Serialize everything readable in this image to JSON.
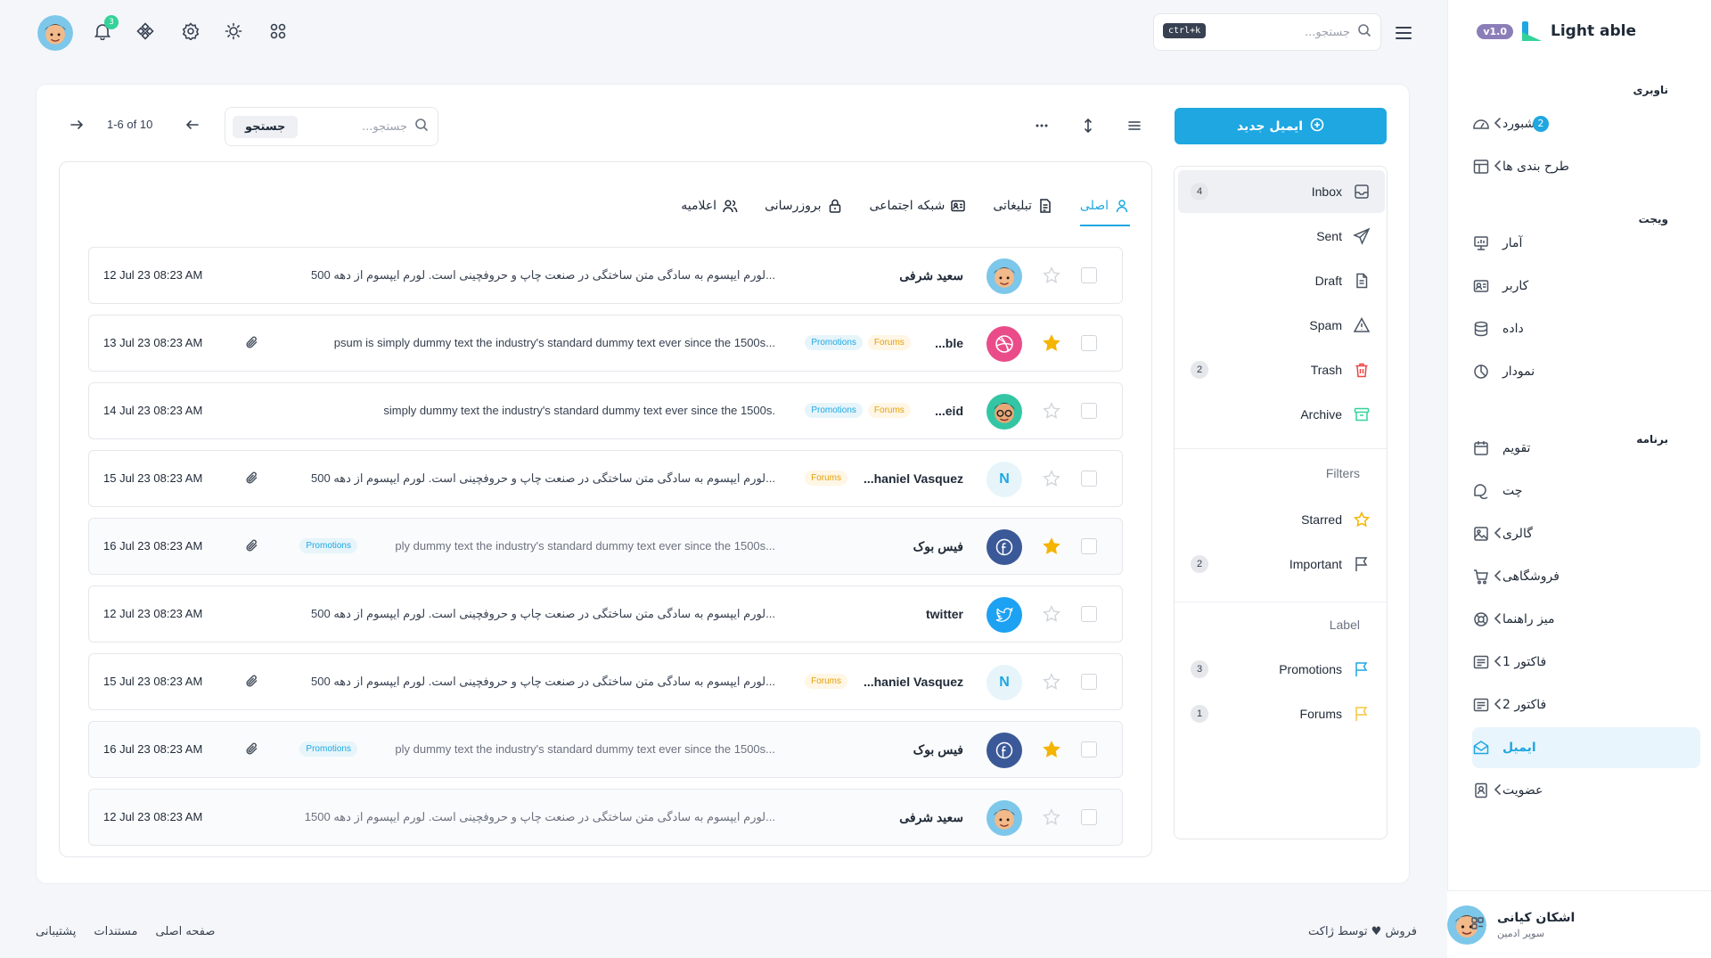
{
  "brand": {
    "name": "Light able",
    "version": "v1.0"
  },
  "sidebar": {
    "sections": [
      "ناوبری",
      "ویجت",
      "برنامه"
    ],
    "items": [
      {
        "label": "داشبورد",
        "icon": "dashboard-icon",
        "badge": "2",
        "chevron": true
      },
      {
        "label": "طرح بندی ها",
        "icon": "layout-icon",
        "chevron": true
      },
      {
        "label": "آمار",
        "icon": "statistics-icon"
      },
      {
        "label": "کاربر",
        "icon": "user-card-icon"
      },
      {
        "label": "داده",
        "icon": "database-icon"
      },
      {
        "label": "نمودار",
        "icon": "chart-pie-icon"
      },
      {
        "label": "تقویم",
        "icon": "calendar-icon"
      },
      {
        "label": "چت",
        "icon": "chat-icon"
      },
      {
        "label": "گالری",
        "icon": "gallery-icon",
        "chevron": true
      },
      {
        "label": "فروشگاهی",
        "icon": "cart-icon",
        "chevron": true
      },
      {
        "label": "میز راهنما",
        "icon": "helpdesk-icon",
        "chevron": true
      },
      {
        "label": "فاکتور 1",
        "icon": "invoice-icon",
        "chevron": true
      },
      {
        "label": "فاکتور 2",
        "icon": "invoice-icon",
        "chevron": true
      },
      {
        "label": "ایمیل",
        "icon": "email-icon",
        "active": true
      },
      {
        "label": "عضویت",
        "icon": "membership-icon",
        "chevron": true
      }
    ],
    "user": {
      "name": "اشکان کیانی",
      "role": "سوپر ادمین"
    }
  },
  "topbar": {
    "search_placeholder": "جستجو...",
    "shortcut": "ctrl+k",
    "notification_count": "3"
  },
  "mail": {
    "compose_label": "ایمیل جدید",
    "folders": [
      {
        "label": "Inbox",
        "icon": "inbox-icon",
        "count": "4",
        "active": true
      },
      {
        "label": "Sent",
        "icon": "send-icon"
      },
      {
        "label": "Draft",
        "icon": "file-icon"
      },
      {
        "label": "Spam",
        "icon": "warning-icon"
      },
      {
        "label": "Trash",
        "icon": "trash-icon",
        "count": "2"
      },
      {
        "label": "Archive",
        "icon": "archive-icon"
      }
    ],
    "filters_heading": "Filters",
    "filters": [
      {
        "label": "Starred",
        "icon": "star-icon"
      },
      {
        "label": "Important",
        "icon": "flag-icon",
        "count": "2"
      }
    ],
    "label_heading": "Label",
    "labels": [
      {
        "label": "Promotions",
        "icon": "flag-icon",
        "count": "3",
        "color": "#1ea7e1"
      },
      {
        "label": "Forums",
        "icon": "flag-icon",
        "count": "1",
        "color": "#f5c542"
      }
    ],
    "search_placeholder": "جستجو...",
    "search_button": "جستجو",
    "pager": "1-6 of 10",
    "tabs": [
      {
        "label": "اصلی",
        "icon": "user-icon",
        "active": true
      },
      {
        "label": "تبلیغاتی",
        "icon": "document-icon"
      },
      {
        "label": "شبکه اجتماعی",
        "icon": "id-card-icon"
      },
      {
        "label": "بروزرسانی",
        "icon": "lock-icon"
      },
      {
        "label": "اعلامیه",
        "icon": "users-icon"
      }
    ],
    "rows": [
      {
        "sender": "سعید شرفی",
        "avatar": "memoji-1",
        "starred": false,
        "labels": [],
        "subject": "لورم ایپسوم به سادگی متن ساختگی در صنعت چاپ و حروفچینی است. لورم ایپسوم از دهه 500...",
        "attachment": false,
        "time": "12 Jul 23 08:23 AM"
      },
      {
        "sender": "ble...",
        "avatar": "dribbble",
        "starred": true,
        "labels": [
          "Promotions",
          "Forums"
        ],
        "subject": "psum is simply dummy text the industry's standard dummy text ever since the 1500s...",
        "attachment": true,
        "time": "13 Jul 23 08:23 AM"
      },
      {
        "sender": "eid...",
        "avatar": "memoji-2",
        "starred": false,
        "labels": [
          "Promotions",
          "Forums"
        ],
        "subject": "simply dummy text the industry's standard dummy text ever since the 1500s.",
        "attachment": false,
        "time": "14 Jul 23 08:23 AM"
      },
      {
        "sender": "haniel Vasquez...",
        "avatar": "N",
        "starred": false,
        "labels": [
          "Forums"
        ],
        "subject": "لورم ایپسوم به سادگی متن ساختگی در صنعت چاپ و حروفچینی است. لورم ایپسوم از دهه 500...",
        "attachment": true,
        "time": "15 Jul 23 08:23 AM"
      },
      {
        "sender": "فیس بوک",
        "avatar": "facebook",
        "starred": true,
        "labels": [],
        "subject_labels": [
          "Promotions"
        ],
        "subject": "ply dummy text the industry's standard dummy text ever since the 1500s...",
        "attachment": true,
        "time": "16 Jul 23 08:23 AM",
        "read": true
      },
      {
        "sender": "twitter",
        "avatar": "twitter",
        "starred": false,
        "labels": [],
        "subject": "لورم ایپسوم به سادگی متن ساختگی در صنعت چاپ و حروفچینی است. لورم ایپسوم از دهه 500...",
        "attachment": false,
        "time": "12 Jul 23 08:23 AM"
      },
      {
        "sender": "haniel Vasquez...",
        "avatar": "N",
        "starred": false,
        "labels": [
          "Forums"
        ],
        "subject": "لورم ایپسوم به سادگی متن ساختگی در صنعت چاپ و حروفچینی است. لورم ایپسوم از دهه 500...",
        "attachment": true,
        "time": "15 Jul 23 08:23 AM"
      },
      {
        "sender": "فیس بوک",
        "avatar": "facebook",
        "starred": true,
        "labels": [],
        "subject_labels": [
          "Promotions"
        ],
        "subject": "ply dummy text the industry's standard dummy text ever since the 1500s...",
        "attachment": true,
        "time": "16 Jul 23 08:23 AM",
        "read": true
      },
      {
        "sender": "سعید شرفی",
        "avatar": "memoji-1",
        "starred": false,
        "labels": [],
        "subject": "لورم ایپسوم به سادگی متن ساختگی در صنعت چاپ و حروفچینی است. لورم ایپسوم از دهه 1500...",
        "attachment": false,
        "time": "12 Jul 23 08:23 AM",
        "read": true
      }
    ]
  },
  "footer": {
    "credit": "فروش ♥ توسط ژاکت",
    "links": [
      "صفحه اصلی",
      "مستندات",
      "پشتیبانی"
    ]
  },
  "colors": {
    "accent": "#1ea7e1",
    "star": "#f5b400",
    "forums": "#e3a008"
  }
}
